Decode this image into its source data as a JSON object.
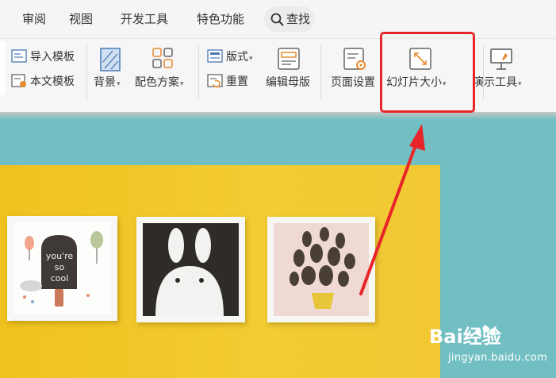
{
  "menubar": {
    "items": [
      {
        "label": "审阅"
      },
      {
        "label": "视图"
      },
      {
        "label": "开发工具"
      },
      {
        "label": "特色功能"
      }
    ],
    "search_label": "查找"
  },
  "ribbon": {
    "import_template": "导入模板",
    "text_template": "本文模板",
    "background": "背景",
    "color_scheme": "配色方案",
    "layout": "版式",
    "reset": "重置",
    "edit_master": "编辑母版",
    "page_setup": "页面设置",
    "slide_size": "幻灯片大小",
    "presentation_tools": "演示工具"
  },
  "artwork": {
    "frame_text": [
      "you're",
      "so",
      "cool"
    ]
  },
  "watermark": {
    "brand": "Bai经验",
    "url": "jingyan.baidu.com"
  },
  "colors": {
    "highlight": "#e8262a",
    "wall": "#f2cc32",
    "background": "#71bfc3"
  }
}
